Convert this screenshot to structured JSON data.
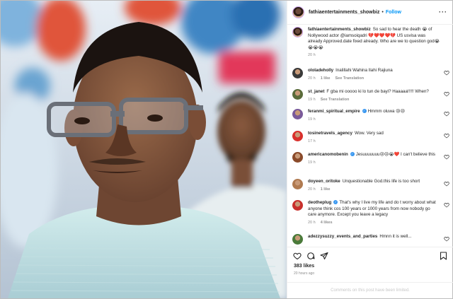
{
  "post": {
    "username": "fathiaentertainments_showbiz",
    "follow_label": "Follow",
    "caption": {
      "user": "fathiaentertainments_showbiz",
      "text": "So sad to hear the death 😭 of Nollywood actor @iamsoiqadri 💔❤️❤️❤️💔 US usvisa was already Approved.date fixed already. Who are we to question god😭😭😭😭",
      "time": "20 h"
    },
    "likes": "383 likes",
    "time_ago": "20 hours ago",
    "comments_disabled": "Comments on this post have been limited."
  },
  "comments": [
    {
      "user": "ololadeholly",
      "text": "Inalillahi Wahina Ilahi Rajiuna",
      "time": "20 h",
      "likes": "1 like",
      "extra": "See Translation",
      "verified": false,
      "avatar_color": "#3a3a3a"
    },
    {
      "user": "st_janet",
      "text": "F gba mi ooooo ki lo tun de bayi? Haaaaa!!!!! When?",
      "time": "19 h",
      "likes": "",
      "extra": "See Translation",
      "verified": false,
      "avatar_color": "#5a6b3a"
    },
    {
      "user": "feranmi_spiritual_empire",
      "text": "Hmmm oluwa 😢😢",
      "time": "19 h",
      "likes": "",
      "extra": "",
      "verified": true,
      "avatar_color": "#7a5a9a"
    },
    {
      "user": "tosinetravels_agency",
      "text": "Wow. Very sad",
      "time": "17 h",
      "likes": "",
      "extra": "",
      "verified": false,
      "avatar_color": "#d9302c"
    },
    {
      "user": "americanomobenin",
      "text": "Jesuuuuuuu😢😢😭❤️ I can't believe this",
      "time": "19 h",
      "likes": "",
      "extra": "",
      "verified": true,
      "avatar_color": "#8a4a2a"
    },
    {
      "user": "doyeen_oritoke",
      "text": "Unquestionable God.this life is too short",
      "time": "20 h",
      "likes": "1 like",
      "extra": "",
      "verified": false,
      "avatar_color": "#b07a50"
    },
    {
      "user": "deotheplug",
      "text": "That's why I live my life and do t worry about what anyone think cos 100 years or 1000 years from now nobody go care anymore. Except you leave a legacy",
      "time": "20 h",
      "likes": "4 likes",
      "extra": "",
      "verified": true,
      "avatar_color": "#c8302c"
    },
    {
      "user": "adezzysuzzy_events_and_parties",
      "text": "Hmnn it is well...",
      "time": "",
      "likes": "",
      "extra": "",
      "verified": false,
      "avatar_color": "#4a7a3a"
    }
  ],
  "icons": {
    "more": "more-horizontal-icon",
    "like": "heart-icon",
    "comment": "comment-icon",
    "share": "paper-plane-icon",
    "save": "bookmark-icon"
  },
  "colors": {
    "link_blue": "#0095f6",
    "muted": "#8e8e8e",
    "verified": "#3897f0"
  }
}
